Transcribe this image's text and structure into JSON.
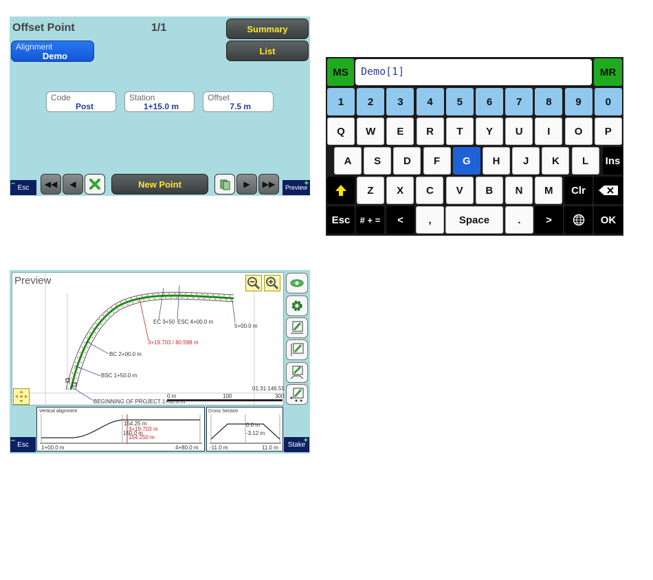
{
  "offset_panel": {
    "title": "Offset Point",
    "counter": "1/1",
    "summary_label": "Summary",
    "list_label": "List",
    "alignment_label": "Alignment",
    "alignment_value": "Demo",
    "fields": [
      {
        "label": "Code",
        "value": "Post"
      },
      {
        "label": "Station",
        "value": "1+15.0 m"
      },
      {
        "label": "Offset",
        "value": "7.5 m"
      }
    ],
    "esc_label": "Esc",
    "new_point_label": "New Point",
    "preview_label": "Preview"
  },
  "keyboard": {
    "ms_label": "MS",
    "mr_label": "MR",
    "input_value": "Demo[1]",
    "row_numbers": [
      "1",
      "2",
      "3",
      "4",
      "5",
      "6",
      "7",
      "8",
      "9",
      "0"
    ],
    "row_q": [
      "Q",
      "W",
      "E",
      "R",
      "T",
      "Y",
      "U",
      "I",
      "O",
      "P"
    ],
    "row_a": [
      "A",
      "S",
      "D",
      "F",
      "G",
      "H",
      "J",
      "K",
      "L"
    ],
    "ins_label": "Ins",
    "row_z": [
      "Z",
      "X",
      "C",
      "V",
      "B",
      "N",
      "M"
    ],
    "clr_label": "Clr",
    "esc_label": "Esc",
    "symbols_label": "# + =",
    "left_label": "<",
    "comma_label": ",",
    "space_label": "Space",
    "dot_label": ".",
    "right_label": ">",
    "ok_label": "OK",
    "selected_key": "G"
  },
  "preview_panel": {
    "title": "Preview",
    "map_labels": {
      "ec": "EC 3+50",
      "esc4": "ESC 4+00.0 m",
      "s500": "5+00.0 m",
      "station_red": "3+19.703 / 80.598 m",
      "bc": "BC 2+00.0 m",
      "bsc": "BSC 1+50.0 m",
      "begin": "BEGINNING OF PROJECT 1+00.0 m",
      "scale_0": "0 m",
      "scale_100": "100",
      "scale_300": "300",
      "time": "01:31:146.51"
    },
    "vertical": {
      "title": "Vertical alignment",
      "elev1": "154.25 m",
      "elev2": "150.0 m",
      "station_red": "3+19.703 m",
      "elev_red": "154.250 m",
      "start": "1+00.0 m",
      "end": "4+80.0 m"
    },
    "cross": {
      "title": "Cross Section",
      "v1": "0.0 m",
      "v2": "-3.12 m",
      "left": "-11.0 m",
      "right": "11.0 m"
    },
    "esc_label": "Esc",
    "stake_label": "Stake"
  },
  "colors": {
    "panel_bg": "#a9dbe0",
    "accent_yellow": "#ffe629",
    "alignment_blue": "#1e62d8",
    "key_number_blue": "#90c8ee",
    "ms_green": "#1faa1f",
    "road_green": "#1a8c1a",
    "station_red": "#d02020"
  }
}
